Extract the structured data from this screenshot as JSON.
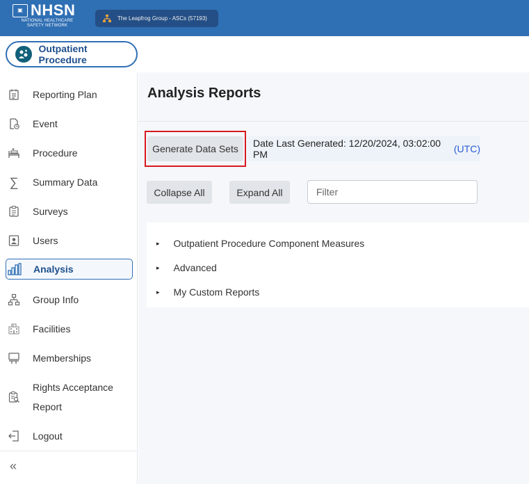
{
  "header": {
    "logo": {
      "badge_text": "▣",
      "wordmark": "NHSN",
      "subtitle_line1": "NATIONAL HEALTHCARE",
      "subtitle_line2": "SAFETY NETWORK"
    },
    "org_selector": {
      "label": "The Leapfrog Group - ASCs (57193)",
      "icon": "org-chart-icon"
    },
    "brand_color": "#2f6fb4"
  },
  "component": {
    "label": "Outpatient Procedure",
    "icon": "outpatient-procedure-icon"
  },
  "sidebar": {
    "items": [
      {
        "label": "Reporting Plan",
        "icon": "calendar-list-icon"
      },
      {
        "label": "Event",
        "icon": "document-clock-icon"
      },
      {
        "label": "Procedure",
        "icon": "hospital-bed-icon"
      },
      {
        "label": "Summary Data",
        "icon": "sigma-icon"
      },
      {
        "label": "Surveys",
        "icon": "clipboard-icon"
      },
      {
        "label": "Users",
        "icon": "user-badge-icon"
      },
      {
        "label": "Analysis",
        "icon": "bar-chart-icon",
        "active": true
      },
      {
        "label": "Group Info",
        "icon": "org-chart-icon"
      },
      {
        "label": "Facilities",
        "icon": "building-icon"
      },
      {
        "label": "Memberships",
        "icon": "monitor-stand-icon"
      },
      {
        "label_line1": "Rights Acceptance",
        "label_line2": "Report",
        "icon": "clipboard-search-icon"
      },
      {
        "label": "Logout",
        "icon": "logout-icon"
      }
    ],
    "collapse_glyph": "«"
  },
  "main": {
    "title": "Analysis Reports",
    "generate_button": "Generate Data Sets",
    "date_label": "Date Last Generated: 12/20/2024, 03:02:00 PM",
    "timezone": "(UTC)",
    "collapse_all": "Collapse All",
    "expand_all": "Expand All",
    "filter_placeholder": "Filter",
    "highlight_color": "#d71920",
    "tree": [
      {
        "label": "Outpatient Procedure Component Measures"
      },
      {
        "label": "Advanced"
      },
      {
        "label": "My Custom Reports"
      }
    ],
    "caret_glyph": "▸"
  }
}
